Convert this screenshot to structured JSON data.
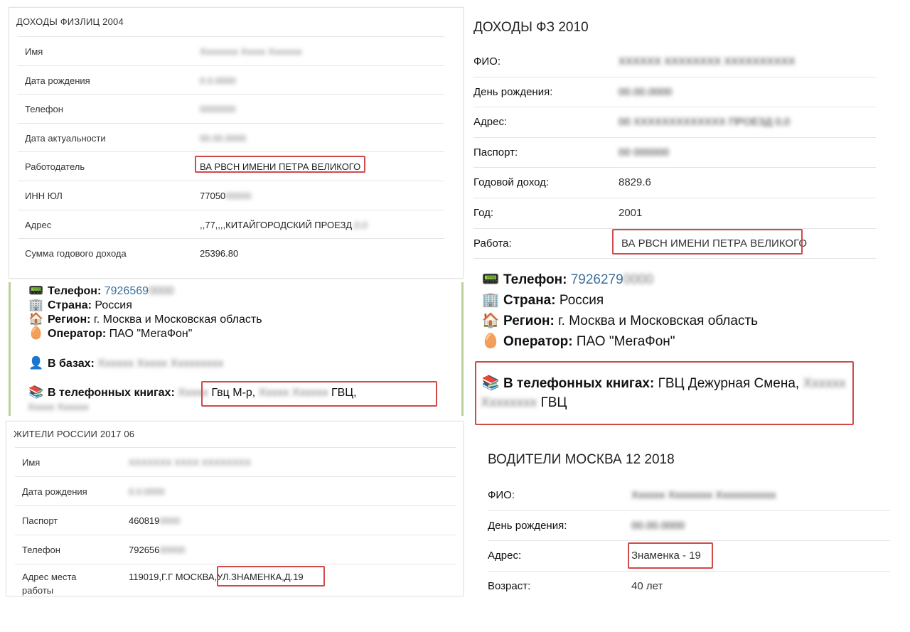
{
  "panel1": {
    "title": "ДОХОДЫ ФИЗЛИЦ 2004",
    "rows": [
      {
        "label": "Имя",
        "value": "",
        "blur": "Хххххххх Ххххх Ххххххх"
      },
      {
        "label": "Дата рождения",
        "value": "",
        "blur": "0.0.0000"
      },
      {
        "label": "Телефон",
        "value": "",
        "blur": "0000000"
      },
      {
        "label": "Дата актуальности",
        "value": "",
        "blur": "00.00.0000"
      },
      {
        "label": "Работодатель",
        "value": "ВА РВСН ИМЕНИ ПЕТРА ВЕЛИКОГО",
        "blur": ""
      },
      {
        "label": "ИНН ЮЛ",
        "value": "77050",
        "blur": "00000"
      },
      {
        "label": "Адрес",
        "value": ",,77,,,,КИТАЙГОРОДСКИЙ ПРОЕЗД",
        "blur": ",0,0"
      },
      {
        "label": "Сумма годового дохода",
        "value": "25396.80",
        "blur": ""
      }
    ]
  },
  "telegram_left": {
    "phone_label": "Телефон:",
    "phone": "7926569",
    "phone_blur": "0000",
    "country_label": "Страна:",
    "country": "Россия",
    "region_label": "Регион:",
    "region": "г. Москва и Московская область",
    "operator_label": "Оператор:",
    "operator": "ПАО \"МегаФон\"",
    "bases_label": "В базах:",
    "bases_blur": "Хххххх Ххххх Ххххххххх",
    "books_label": "В телефонных книгах:",
    "books_blur1": "Ххххх",
    "books_text1": "Гвц М-р,",
    "books_blur2": "Ххххх Хххххх",
    "books_text2": "ГВЦ,",
    "books_blur3": "Ххххх Хххххх"
  },
  "panel2": {
    "title": "ЖИТЕЛИ РОССИИ 2017 06",
    "rows": [
      {
        "label": "Имя",
        "value": "",
        "blur": "ХХХХХХХ ХХХХ ХХХХХХХХ"
      },
      {
        "label": "Дата рождения",
        "value": "",
        "blur": "0.0.0000"
      },
      {
        "label": "Паспорт",
        "value": "460819",
        "blur": "0000"
      },
      {
        "label": "Телефон",
        "value": "792656",
        "blur": "00000"
      },
      {
        "label": "Адрес места работы",
        "value": "119019,Г.Г МОСКВА,УЛ.ЗНАМЕНКА,Д.19",
        "blur": ""
      }
    ]
  },
  "right1": {
    "title": "ДОХОДЫ ФЗ 2010",
    "rows": [
      {
        "label": "ФИО:",
        "value": "",
        "blur": "ХХХХХХ ХХХХХХХХ ХХХХХХХХХХ"
      },
      {
        "label": "День рождения:",
        "value": "",
        "blur": "00.00.0000"
      },
      {
        "label": "Адрес:",
        "value": "",
        "blur": "00 ХХХХХХХХХХХХХ ПРОЕЗД 0,0"
      },
      {
        "label": "Паспорт:",
        "value": "",
        "blur": "00 000000"
      },
      {
        "label": "Годовой доход:",
        "value": "8829.6",
        "blur": ""
      },
      {
        "label": "Год:",
        "value": "2001",
        "blur": ""
      },
      {
        "label": "Работа:",
        "value": "ВА РВСН ИМЕНИ ПЕТРА ВЕЛИКОГО",
        "blur": ""
      }
    ]
  },
  "telegram_right": {
    "phone_label": "Телефон:",
    "phone": "7926279",
    "phone_blur": "0000",
    "country_label": "Страна:",
    "country": "Россия",
    "region_label": "Регион:",
    "region": "г. Москва и Московская область",
    "operator_label": "Оператор:",
    "operator": "ПАО \"МегаФон\"",
    "books_label": "В телефонных книгах:",
    "books_text1": "ГВЦ Дежурная Смена,",
    "books_blur1": "Хххххх",
    "books_blur2": "Хххххххх",
    "books_text2": "ГВЦ"
  },
  "right2": {
    "title": "ВОДИТЕЛИ МОСКВА 12 2018",
    "rows": [
      {
        "label": "ФИО:",
        "value": "",
        "blur": "Хххххх Хххххххх Ххххххххххх"
      },
      {
        "label": "День рождения:",
        "value": "",
        "blur": "00.00.0000"
      },
      {
        "label": "Адрес:",
        "value": "Знаменка - 19",
        "blur": ""
      },
      {
        "label": "Возраст:",
        "value": "40 лет",
        "blur": ""
      }
    ]
  },
  "icons": {
    "pager": "📟",
    "buildings": "🏢",
    "house": "🏠",
    "egg": "🥚",
    "person": "👤",
    "books": "📚"
  },
  "colors": {
    "highlight_border": "#d04a4a",
    "telegram_border": "#b9d29a",
    "phone_link": "#3d6f9b"
  }
}
